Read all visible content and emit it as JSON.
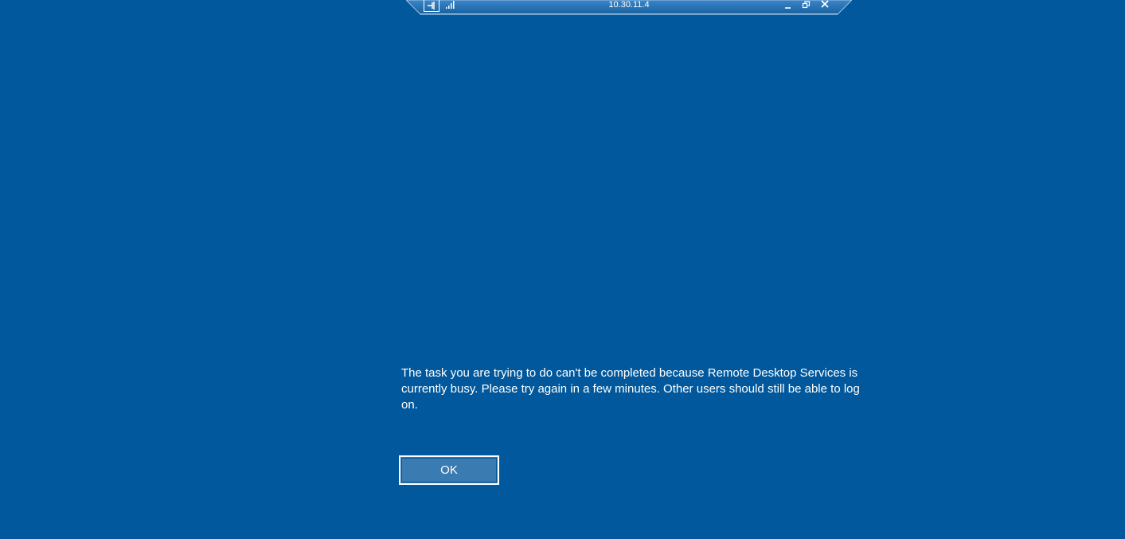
{
  "connection_bar": {
    "title": "10.30.11.4",
    "icons": {
      "pin": "pin-icon",
      "signal": "signal-strength-icon",
      "minimize": "minimize-icon",
      "restore": "restore-icon",
      "close": "close-icon"
    }
  },
  "dialog": {
    "message": "The task you are trying to do can't be completed because Remote Desktop Services is currently busy. Please try again in a few minutes. Other users should still be able to log on.",
    "ok_label": "OK"
  },
  "colors": {
    "background": "#01589c",
    "bar": "#1f67ae",
    "button": "#3a7bb2",
    "text": "#ffffff"
  }
}
